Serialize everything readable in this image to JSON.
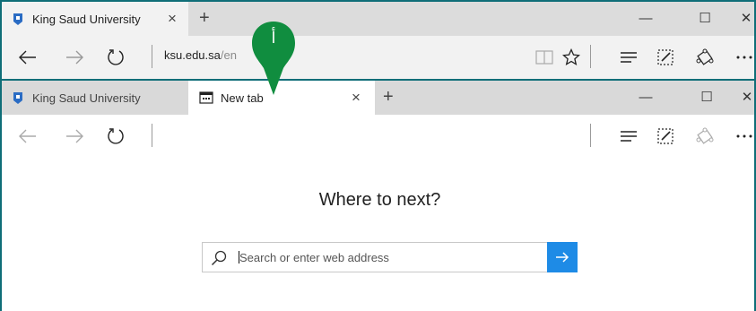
{
  "window1": {
    "tabs": [
      {
        "label": "King Saud University",
        "close": "×"
      }
    ],
    "new_tab": "+",
    "controls": {
      "minimize": "—",
      "maximize": "☐",
      "close": "✕"
    },
    "address": {
      "domain": "ksu.edu.sa",
      "path": "/en"
    }
  },
  "window2": {
    "tabs": [
      {
        "label": "King Saud University"
      },
      {
        "label": "New tab",
        "close": "×"
      }
    ],
    "new_tab": "+",
    "controls": {
      "minimize": "—",
      "maximize": "☐",
      "close": "✕"
    },
    "page": {
      "headline": "Where to next?",
      "search_placeholder": "Search or enter web address"
    }
  },
  "callout": {
    "label": "أ"
  },
  "colors": {
    "accent_blue": "#1e8be6",
    "callout_green": "#108d3f",
    "frame_teal": "#0f6e78",
    "favicon_blue": "#2a6cc4"
  },
  "icons": [
    "back-arrow-icon",
    "forward-arrow-icon",
    "refresh-icon",
    "reading-view-icon",
    "favorite-star-icon",
    "hub-icon",
    "web-note-icon",
    "share-icon",
    "more-icon",
    "search-icon",
    "go-arrow-icon",
    "new-tab-page-icon"
  ]
}
